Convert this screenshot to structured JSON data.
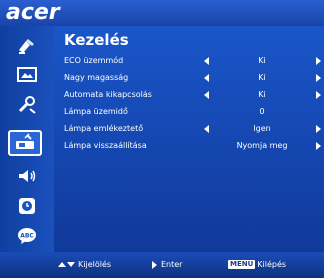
{
  "brand": {
    "logo_text": "acer"
  },
  "menu": {
    "title": "Kezelés",
    "rows": [
      {
        "label": "ECO üzemmód",
        "value": "Ki",
        "has_arrows": true
      },
      {
        "label": "Nagy magasság",
        "value": "Ki",
        "has_arrows": true
      },
      {
        "label": "Automata kikapcsolás",
        "value": "Ki",
        "has_arrows": true
      },
      {
        "label": "Lámpa üzemidő",
        "value": "0",
        "has_arrows": false
      },
      {
        "label": "Lámpa emlékeztető",
        "value": "Igen",
        "has_arrows": true
      },
      {
        "label": "Lámpa visszaállítása",
        "value": "Nyomja meg",
        "has_arrows": false,
        "right_arrow_only": true
      }
    ]
  },
  "sidebar": {
    "items": [
      {
        "icon": "color-management-icon"
      },
      {
        "icon": "image-settings-icon"
      },
      {
        "icon": "settings-tools-icon"
      },
      {
        "icon": "lamp-management-icon",
        "selected": true
      },
      {
        "icon": "audio-icon"
      },
      {
        "icon": "timer-icon"
      },
      {
        "icon": "language-icon",
        "icon_text": "ABC"
      }
    ]
  },
  "footer": {
    "select_label": "Kijelölés",
    "enter_label": "Enter",
    "menu_key": "MENU",
    "exit_label": "Kilépés"
  },
  "colors": {
    "background": "#123a8f",
    "accent": "#1a56c9",
    "text": "#ffffff"
  }
}
